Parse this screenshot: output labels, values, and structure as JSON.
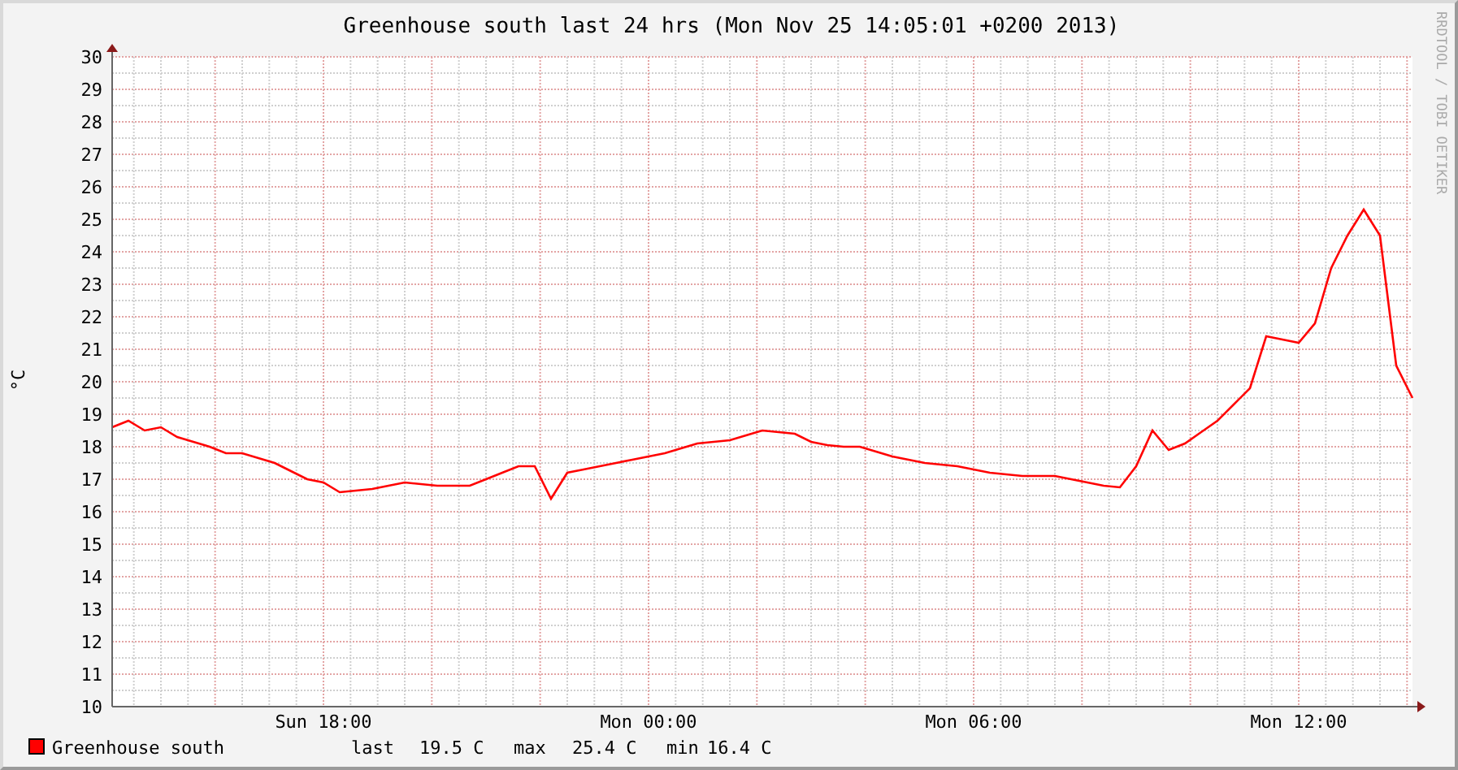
{
  "title": "Greenhouse south last 24 hrs (Mon Nov 25 14:05:01 +0200 2013)",
  "watermark": "RRDTOOL / TOBI OETIKER",
  "chart_data": {
    "type": "line",
    "grid": true,
    "ylabel": "°C",
    "ylim": [
      10,
      30
    ],
    "yticks": [
      10,
      11,
      12,
      13,
      14,
      15,
      16,
      17,
      18,
      19,
      20,
      21,
      22,
      23,
      24,
      25,
      26,
      27,
      28,
      29,
      30
    ],
    "categories": [
      null,
      null,
      null,
      null,
      null,
      null,
      null,
      null,
      null,
      null,
      null,
      null,
      null,
      "Sun 18:00",
      null,
      null,
      null,
      null,
      null,
      null,
      null,
      null,
      null,
      null,
      null,
      null,
      null,
      null,
      null,
      null,
      null,
      null,
      null,
      "Mon 00:00",
      null,
      null,
      null,
      null,
      null,
      null,
      null,
      null,
      null,
      null,
      null,
      null,
      null,
      null,
      null,
      null,
      null,
      null,
      null,
      "Mon 06:00",
      null,
      null,
      null,
      null,
      null,
      null,
      null,
      null,
      null,
      null,
      null,
      null,
      null,
      null,
      null,
      null,
      null,
      null,
      null,
      "Mon 12:00",
      null,
      null,
      null,
      null,
      null,
      null,
      null
    ],
    "series": [
      {
        "name": "Greenhouse south",
        "color": "#ff0000",
        "values": [
          18.6,
          18.8,
          18.5,
          18.6,
          18.3,
          18.15,
          18.0,
          17.8,
          17.8,
          17.65,
          17.5,
          17.25,
          17.0,
          16.9,
          16.6,
          16.65,
          16.7,
          16.8,
          16.9,
          16.85,
          16.8,
          16.8,
          16.8,
          17.0,
          17.2,
          17.4,
          17.4,
          16.4,
          17.2,
          17.3,
          17.4,
          17.5,
          17.6,
          17.7,
          17.8,
          17.95,
          18.1,
          18.15,
          18.2,
          18.35,
          18.5,
          18.45,
          18.4,
          18.15,
          18.05,
          18.0,
          18.0,
          17.85,
          17.7,
          17.6,
          17.5,
          17.45,
          17.4,
          17.3,
          17.2,
          17.15,
          17.1,
          17.1,
          17.1,
          17.0,
          16.9,
          16.8,
          16.75,
          17.4,
          18.5,
          17.9,
          18.1,
          18.45,
          18.8,
          19.3,
          19.8,
          21.4,
          21.3,
          21.2,
          21.8,
          23.5,
          24.5,
          25.3,
          24.5,
          20.5,
          19.5
        ]
      }
    ]
  },
  "legend": {
    "stats": [
      {
        "label": "last",
        "value": "19.5 C"
      },
      {
        "label": "max",
        "value": "25.4 C"
      },
      {
        "label": "min",
        "value": "16.4 C"
      }
    ]
  }
}
